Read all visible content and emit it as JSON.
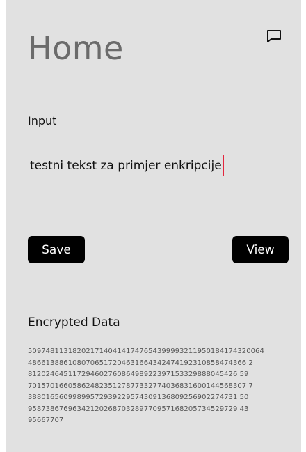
{
  "home": {
    "title": "Home",
    "chat_icon": "message-square-icon"
  },
  "input": {
    "label": "Input",
    "value": "testni tekst za primjer enkripcije"
  },
  "actions": {
    "save_label": "Save",
    "view_label": "View"
  },
  "encrypted": {
    "label": "Encrypted Data",
    "lines": [
      "50974811318202171404141747654399993211950184174320064",
      "4866138861080706517204631664342474192310858474366 2",
      "81202464511729460276086498922397153329888045426 59",
      "7015701660586248235127877332774036831600144568307 7",
      "38801656099899572939229574309136809256902274731 50",
      "95873867696342120268703289770957168205734529729 43",
      "95667707"
    ]
  },
  "colors": {
    "background": "#e1e1e1",
    "title": "#6b6b6b",
    "button": "#000000",
    "caret": "#e3263e"
  }
}
